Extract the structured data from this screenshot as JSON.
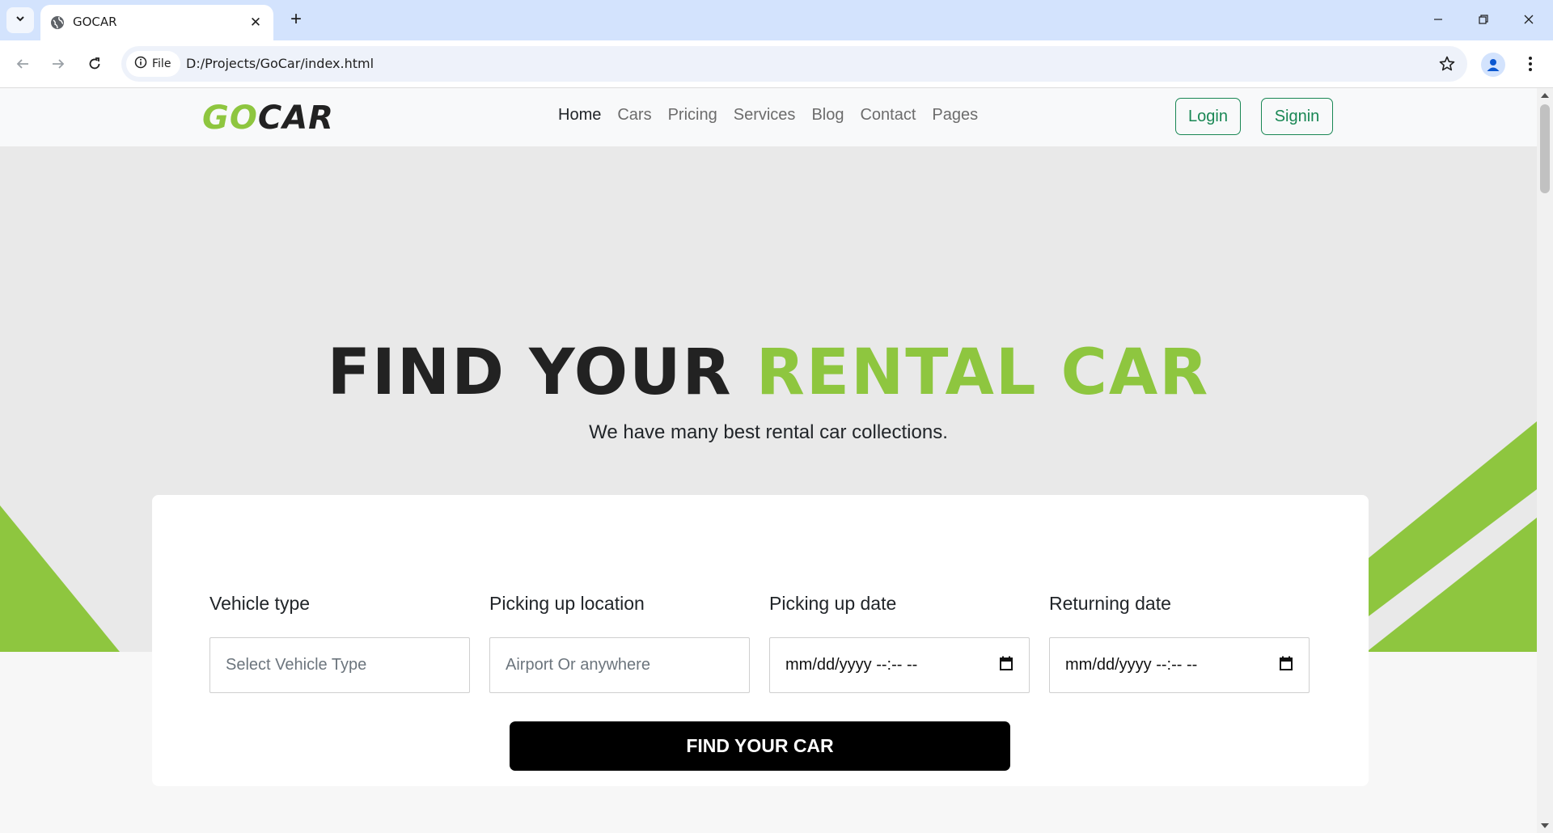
{
  "browser": {
    "tab_title": "GOCAR",
    "site_info_label": "File",
    "url": "D:/Projects/GoCar/index.html"
  },
  "nav": {
    "logo_go": "GO",
    "logo_car": "CAR",
    "links": [
      "Home",
      "Cars",
      "Pricing",
      "Services",
      "Blog",
      "Contact",
      "Pages"
    ],
    "active": "Home",
    "login": "Login",
    "signin": "Signin"
  },
  "hero": {
    "title_part1": "FIND YOUR",
    "title_part2": "RENTAL CAR",
    "subtitle": "We have many best rental car collections."
  },
  "search": {
    "fields": [
      {
        "label": "Vehicle type",
        "placeholder": "Select Vehicle Type"
      },
      {
        "label": "Picking up location",
        "placeholder": "Airport Or anywhere"
      },
      {
        "label": "Picking up date",
        "value": "mm/dd/yyyy --:-- --"
      },
      {
        "label": "Returning date",
        "value": "mm/dd/yyyy --:-- --"
      }
    ],
    "button": "FIND YOUR CAR"
  },
  "colors": {
    "accent_green": "#8ec63f",
    "button_green": "#198754",
    "chrome_blue": "#d3e3fd"
  }
}
